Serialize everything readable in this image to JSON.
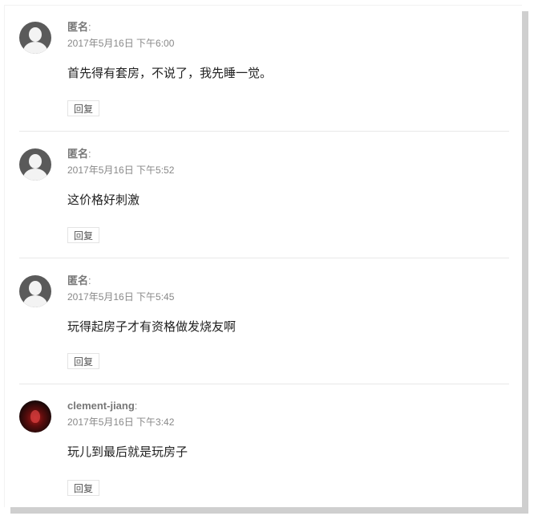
{
  "comments": [
    {
      "author": "匿名",
      "colon": ":",
      "date": "2017年5月16日 下午6:00",
      "content": "首先得有套房，不说了，我先睡一觉。",
      "reply_label": "回复",
      "avatar": "default-avatar-icon"
    },
    {
      "author": "匿名",
      "colon": ":",
      "date": "2017年5月16日 下午5:52",
      "content": "这价格好刺激",
      "reply_label": "回复",
      "avatar": "default-avatar-icon"
    },
    {
      "author": "匿名",
      "colon": ":",
      "date": "2017年5月16日 下午5:45",
      "content": "玩得起房子才有资格做发烧友啊",
      "reply_label": "回复",
      "avatar": "default-avatar-icon"
    },
    {
      "author": "clement-jiang",
      "colon": ":",
      "date": "2017年5月16日 下午3:42",
      "content": "玩儿到最后就是玩房子",
      "reply_label": "回复",
      "avatar": "user-photo-avatar"
    }
  ],
  "colors": {
    "author": "#777777",
    "date": "#888888",
    "content": "#222222",
    "divider": "#e8e8e8",
    "shadow": "#cfcfcf"
  }
}
